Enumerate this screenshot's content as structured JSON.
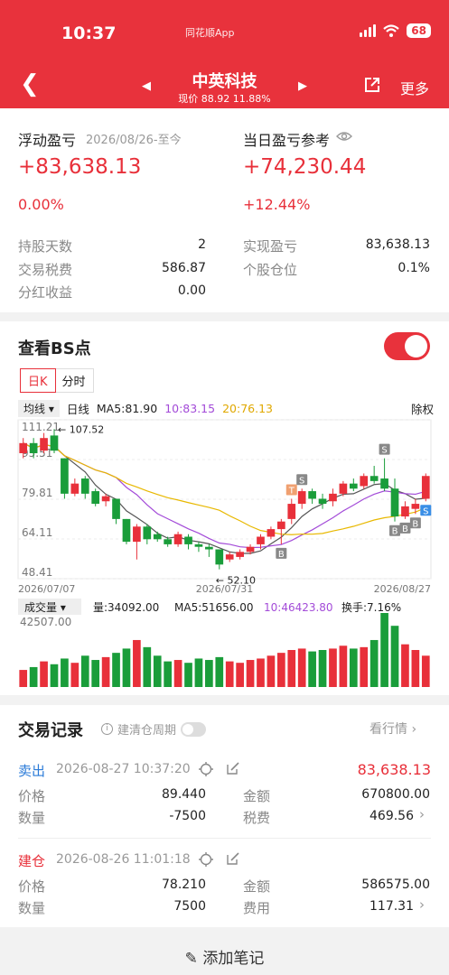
{
  "status": {
    "time": "10:37",
    "app": "同花顺App",
    "battery": "68"
  },
  "nav": {
    "title": "中英科技",
    "subtitle": "现价 88.92 11.88%",
    "more": "更多"
  },
  "pnl": {
    "floating_label": "浮动盈亏",
    "floating_date": "2026/08/26-至今",
    "floating_value": "+83,638.13",
    "floating_pct": "0.00%",
    "daily_label": "当日盈亏参考",
    "daily_value": "+74,230.44",
    "daily_pct": "+12.44%",
    "rows": [
      {
        "k1": "持股天数",
        "v1": "2",
        "k2": "实现盈亏",
        "v2": "83,638.13"
      },
      {
        "k1": "交易税费",
        "v1": "586.87",
        "k2": "个股仓位",
        "v2": "0.1%"
      },
      {
        "k1": "分红收益",
        "v1": "0.00",
        "k2": "",
        "v2": ""
      }
    ]
  },
  "bs": {
    "title": "查看BS点",
    "tab_day": "日K",
    "tab_time": "分时",
    "ma_selector": "均线",
    "period": "日线",
    "ma5": "MA5:81.90",
    "ma10": "10:83.15",
    "ma20": "20:76.13",
    "adjust": "除权",
    "vol_selector": "成交量",
    "vol": "量:34092.00",
    "vol_ma5": "MA5:51656.00",
    "vol_ma10": "10:46423.80",
    "turnover": "换手:7.16%",
    "vol_axis": "42507.00"
  },
  "chart_data": {
    "type": "candlestick",
    "y_ticks": [
      "111.21",
      "95.51",
      "79.81",
      "64.11",
      "48.41"
    ],
    "x_labels": [
      "2026/07/07",
      "2026/07/31",
      "2026/08/27"
    ],
    "high_annotation": "107.52",
    "low_annotation": "52.10",
    "ylim": [
      48.41,
      111.21
    ],
    "candles": [
      {
        "o": 98,
        "c": 102,
        "h": 104,
        "l": 96
      },
      {
        "o": 102,
        "c": 98,
        "h": 104,
        "l": 96
      },
      {
        "o": 99,
        "c": 104,
        "h": 106,
        "l": 98
      },
      {
        "o": 105,
        "c": 99,
        "h": 107.52,
        "l": 98
      },
      {
        "o": 96,
        "c": 82,
        "h": 96,
        "l": 80
      },
      {
        "o": 82,
        "c": 86,
        "h": 88,
        "l": 81
      },
      {
        "o": 88,
        "c": 82,
        "h": 89,
        "l": 80
      },
      {
        "o": 83,
        "c": 78,
        "h": 84,
        "l": 77
      },
      {
        "o": 79,
        "c": 81,
        "h": 82,
        "l": 77
      },
      {
        "o": 80,
        "c": 72,
        "h": 80,
        "l": 70
      },
      {
        "o": 72,
        "c": 63,
        "h": 72,
        "l": 62
      },
      {
        "o": 63,
        "c": 69,
        "h": 70,
        "l": 56
      },
      {
        "o": 69,
        "c": 64,
        "h": 70,
        "l": 62
      },
      {
        "o": 66,
        "c": 64,
        "h": 67,
        "l": 63
      },
      {
        "o": 64,
        "c": 62,
        "h": 65,
        "l": 61
      },
      {
        "o": 62,
        "c": 66,
        "h": 67,
        "l": 61
      },
      {
        "o": 65,
        "c": 62,
        "h": 66,
        "l": 60
      },
      {
        "o": 62,
        "c": 61,
        "h": 63,
        "l": 59
      },
      {
        "o": 61,
        "c": 60,
        "h": 62,
        "l": 57
      },
      {
        "o": 60,
        "c": 54,
        "h": 60,
        "l": 52.1
      },
      {
        "o": 56,
        "c": 58,
        "h": 59,
        "l": 55
      },
      {
        "o": 57,
        "c": 59,
        "h": 60,
        "l": 56
      },
      {
        "o": 59,
        "c": 61,
        "h": 62,
        "l": 58
      },
      {
        "o": 62,
        "c": 65,
        "h": 66,
        "l": 60
      },
      {
        "o": 65,
        "c": 68,
        "h": 69,
        "l": 64
      },
      {
        "o": 68,
        "c": 71,
        "h": 72,
        "l": 62
      },
      {
        "o": 72,
        "c": 78,
        "h": 80,
        "l": 70
      },
      {
        "o": 78,
        "c": 83,
        "h": 84,
        "l": 76
      },
      {
        "o": 83,
        "c": 80,
        "h": 84,
        "l": 78
      },
      {
        "o": 80,
        "c": 78,
        "h": 82,
        "l": 76
      },
      {
        "o": 79,
        "c": 82,
        "h": 84,
        "l": 77
      },
      {
        "o": 82,
        "c": 86,
        "h": 87,
        "l": 81
      },
      {
        "o": 86,
        "c": 84,
        "h": 88,
        "l": 83
      },
      {
        "o": 85,
        "c": 89,
        "h": 90,
        "l": 84
      },
      {
        "o": 89,
        "c": 87,
        "h": 93,
        "l": 86
      },
      {
        "o": 88,
        "c": 84,
        "h": 96,
        "l": 83
      },
      {
        "o": 84,
        "c": 73,
        "h": 88,
        "l": 71
      },
      {
        "o": 73,
        "c": 77,
        "h": 79,
        "l": 72
      },
      {
        "o": 76,
        "c": 78,
        "h": 80,
        "l": 74
      },
      {
        "o": 80,
        "c": 89,
        "h": 90,
        "l": 79
      }
    ],
    "volumes": [
      12,
      14,
      18,
      16,
      20,
      17,
      22,
      19,
      21,
      24,
      27,
      33,
      28,
      22,
      18,
      19,
      17,
      20,
      19,
      21,
      18,
      17,
      19,
      20,
      22,
      24,
      26,
      27,
      25,
      26,
      27,
      29,
      27,
      28,
      33,
      52,
      43,
      30,
      26,
      22
    ],
    "markers": [
      {
        "i": 26,
        "t": "T",
        "side": "top"
      },
      {
        "i": 27,
        "t": "S",
        "side": "top"
      },
      {
        "i": 25,
        "t": "B",
        "side": "bottom"
      },
      {
        "i": 35,
        "t": "S",
        "side": "top"
      },
      {
        "i": 36,
        "t": "B",
        "side": "bottom"
      },
      {
        "i": 37,
        "t": "B",
        "side": "bottom"
      },
      {
        "i": 38,
        "t": "B",
        "side": "bottom"
      },
      {
        "i": 39,
        "t": "S",
        "side": "bottom"
      }
    ]
  },
  "trades": {
    "title": "交易记录",
    "clear_label": "建清仓周期",
    "view_quote": "看行情",
    "items": [
      {
        "type": "卖出",
        "time": "2026-08-27 10:37:20",
        "amount_head": "83,638.13",
        "k1": "价格",
        "v1": "89.440",
        "k2": "金额",
        "v2": "670800.00",
        "k3": "数量",
        "v3": "-7500",
        "k4": "税费",
        "v4": "469.56"
      },
      {
        "type": "建仓",
        "time": "2026-08-26 11:01:18",
        "amount_head": "",
        "k1": "价格",
        "v1": "78.210",
        "k2": "金额",
        "v2": "586575.00",
        "k3": "数量",
        "v3": "7500",
        "k4": "费用",
        "v4": "117.31"
      }
    ]
  },
  "footer": {
    "add_note": "添加笔记"
  }
}
